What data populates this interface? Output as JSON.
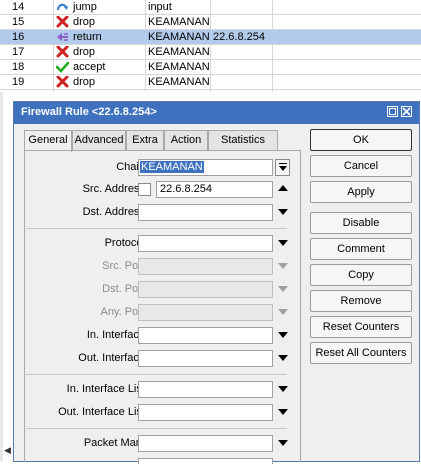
{
  "rules_list": [
    {
      "num": "14",
      "action": "jump",
      "icon": "jump-icon",
      "chain": "input",
      "dst": ""
    },
    {
      "num": "15",
      "action": "drop",
      "icon": "drop-icon",
      "chain": "KEAMANAN",
      "dst": ""
    },
    {
      "num": "16",
      "action": "return",
      "icon": "return-icon",
      "chain": "KEAMANAN",
      "dst": "22.6.8.254",
      "selected": true
    },
    {
      "num": "17",
      "action": "drop",
      "icon": "drop-icon",
      "chain": "KEAMANAN",
      "dst": ""
    },
    {
      "num": "18",
      "action": "accept",
      "icon": "accept-icon",
      "chain": "KEAMANAN",
      "dst": ""
    },
    {
      "num": "19",
      "action": "drop",
      "icon": "drop-icon",
      "chain": "KEAMANAN",
      "dst": ""
    }
  ],
  "window": {
    "title": "Firewall Rule <22.6.8.254>",
    "tabs": [
      "General",
      "Advanced",
      "Extra",
      "Action",
      "Statistics"
    ],
    "active_tab": "General"
  },
  "fields": {
    "chain": {
      "label": "Chain:",
      "value": "KEAMANAN"
    },
    "src_address": {
      "label": "Src. Address:",
      "value": "22.6.8.254"
    },
    "dst_address": {
      "label": "Dst. Address:",
      "value": ""
    },
    "protocol": {
      "label": "Protocol:",
      "value": ""
    },
    "src_port": {
      "label": "Src. Port:",
      "value": ""
    },
    "dst_port": {
      "label": "Dst. Port:",
      "value": ""
    },
    "any_port": {
      "label": "Any. Port:",
      "value": ""
    },
    "in_interface": {
      "label": "In. Interface:",
      "value": ""
    },
    "out_interface": {
      "label": "Out. Interface:",
      "value": ""
    },
    "in_interface_list": {
      "label": "In. Interface List:",
      "value": ""
    },
    "out_interface_list": {
      "label": "Out. Interface List:",
      "value": ""
    },
    "packet_mark": {
      "label": "Packet Mark:",
      "value": ""
    }
  },
  "buttons": {
    "ok": "OK",
    "cancel": "Cancel",
    "apply": "Apply",
    "disable": "Disable",
    "comment": "Comment",
    "copy": "Copy",
    "remove": "Remove",
    "reset_counters": "Reset Counters",
    "reset_all_counters": "Reset All Counters"
  },
  "colors": {
    "titlebar": "#3e71be",
    "selected_row": "#b3cbeb",
    "drop": "#cc2222",
    "accept": "#22aa22",
    "return": "#8a5cc8",
    "jump": "#3a7fc8"
  }
}
